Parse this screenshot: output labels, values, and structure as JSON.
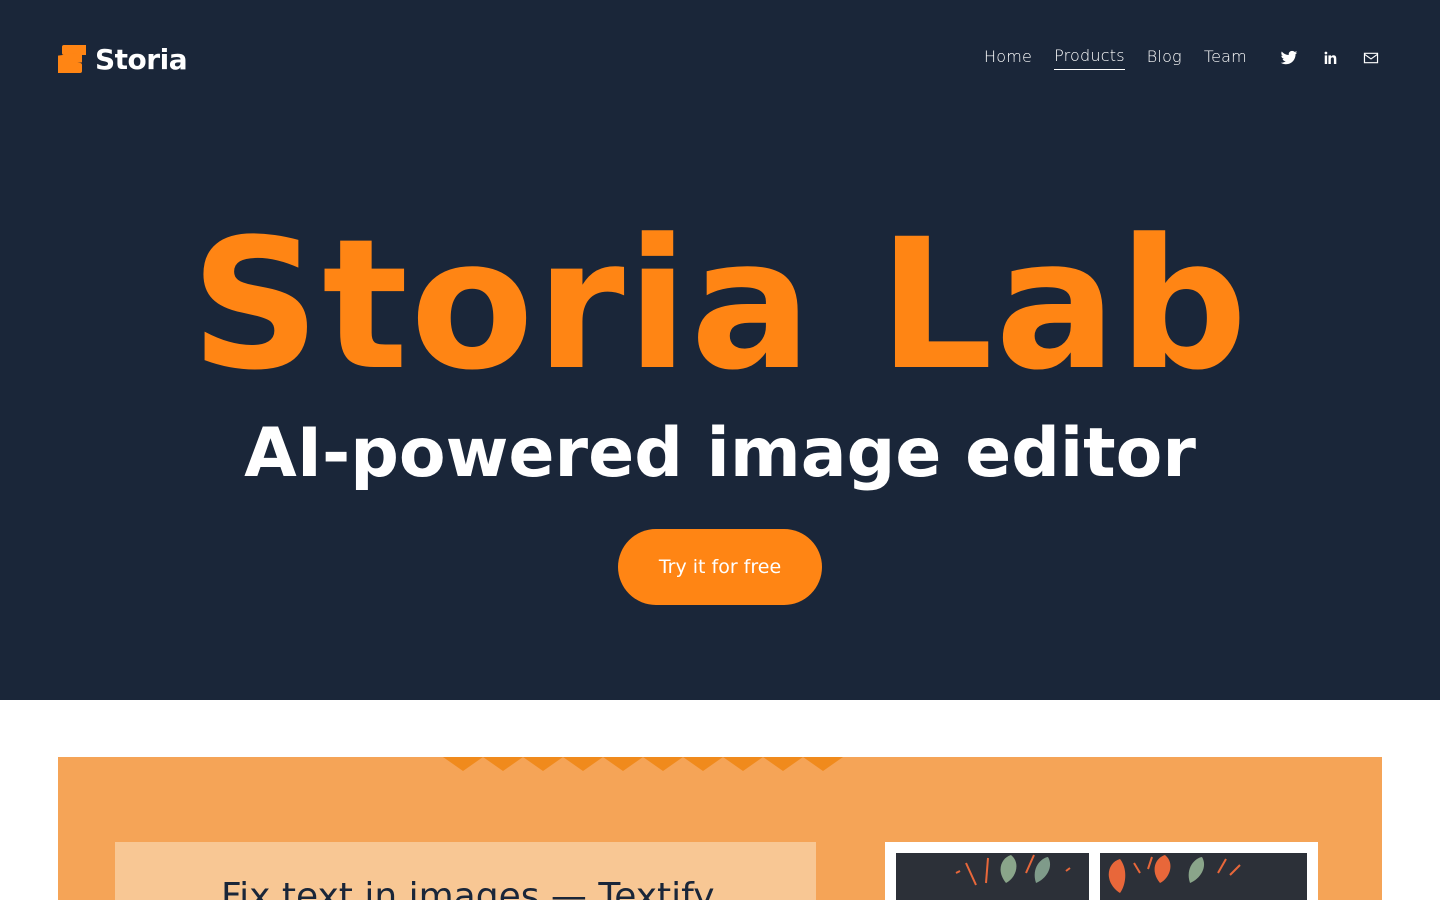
{
  "brand": {
    "name": "Storia",
    "icon": "storia-logo-icon",
    "accent": "#ff8514"
  },
  "nav": {
    "items": [
      {
        "label": "Home",
        "active": false
      },
      {
        "label": "Products",
        "active": true
      },
      {
        "label": "Blog",
        "active": false
      },
      {
        "label": "Team",
        "active": false
      }
    ],
    "socials": [
      "twitter-icon",
      "linkedin-icon",
      "email-icon"
    ]
  },
  "hero": {
    "title": "Storia Lab",
    "subtitle": "AI-powered image editor",
    "cta_label": "Try it for free",
    "background": "#1a2639"
  },
  "promo": {
    "heading": "Fix text in images — Textify",
    "background": "#f5a457"
  }
}
